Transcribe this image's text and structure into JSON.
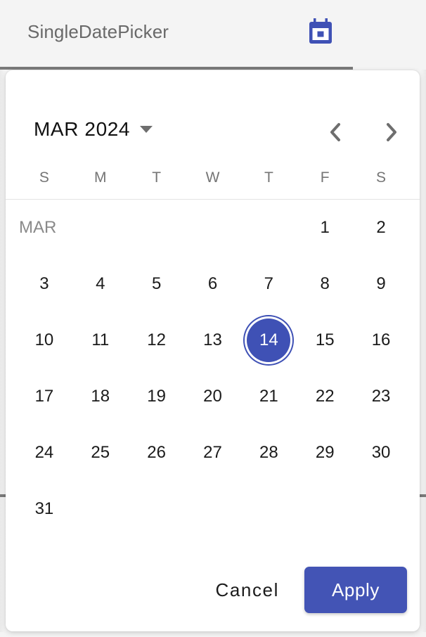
{
  "field": {
    "label": "SingleDatePicker",
    "icon": "calendar-icon",
    "icon_color": "#3f51b5"
  },
  "calendar": {
    "month_year_label": "MAR 2024",
    "dropdown_icon": "chevron-down-icon",
    "prev_icon": "chevron-left-icon",
    "next_icon": "chevron-right-icon",
    "month_tag": "MAR",
    "weekdays": [
      "S",
      "M",
      "T",
      "W",
      "T",
      "F",
      "S"
    ],
    "selected_day": "14",
    "accent_color": "#3f51b5",
    "weeks": [
      [
        "MAR",
        "",
        "",
        "",
        "",
        "1",
        "2"
      ],
      [
        "3",
        "4",
        "5",
        "6",
        "7",
        "8",
        "9"
      ],
      [
        "10",
        "11",
        "12",
        "13",
        "14",
        "15",
        "16"
      ],
      [
        "17",
        "18",
        "19",
        "20",
        "21",
        "22",
        "23"
      ],
      [
        "24",
        "25",
        "26",
        "27",
        "28",
        "29",
        "30"
      ],
      [
        "31",
        "",
        "",
        "",
        "",
        "",
        ""
      ]
    ]
  },
  "actions": {
    "cancel_label": "Cancel",
    "apply_label": "Apply",
    "apply_color": "#4354b5"
  }
}
